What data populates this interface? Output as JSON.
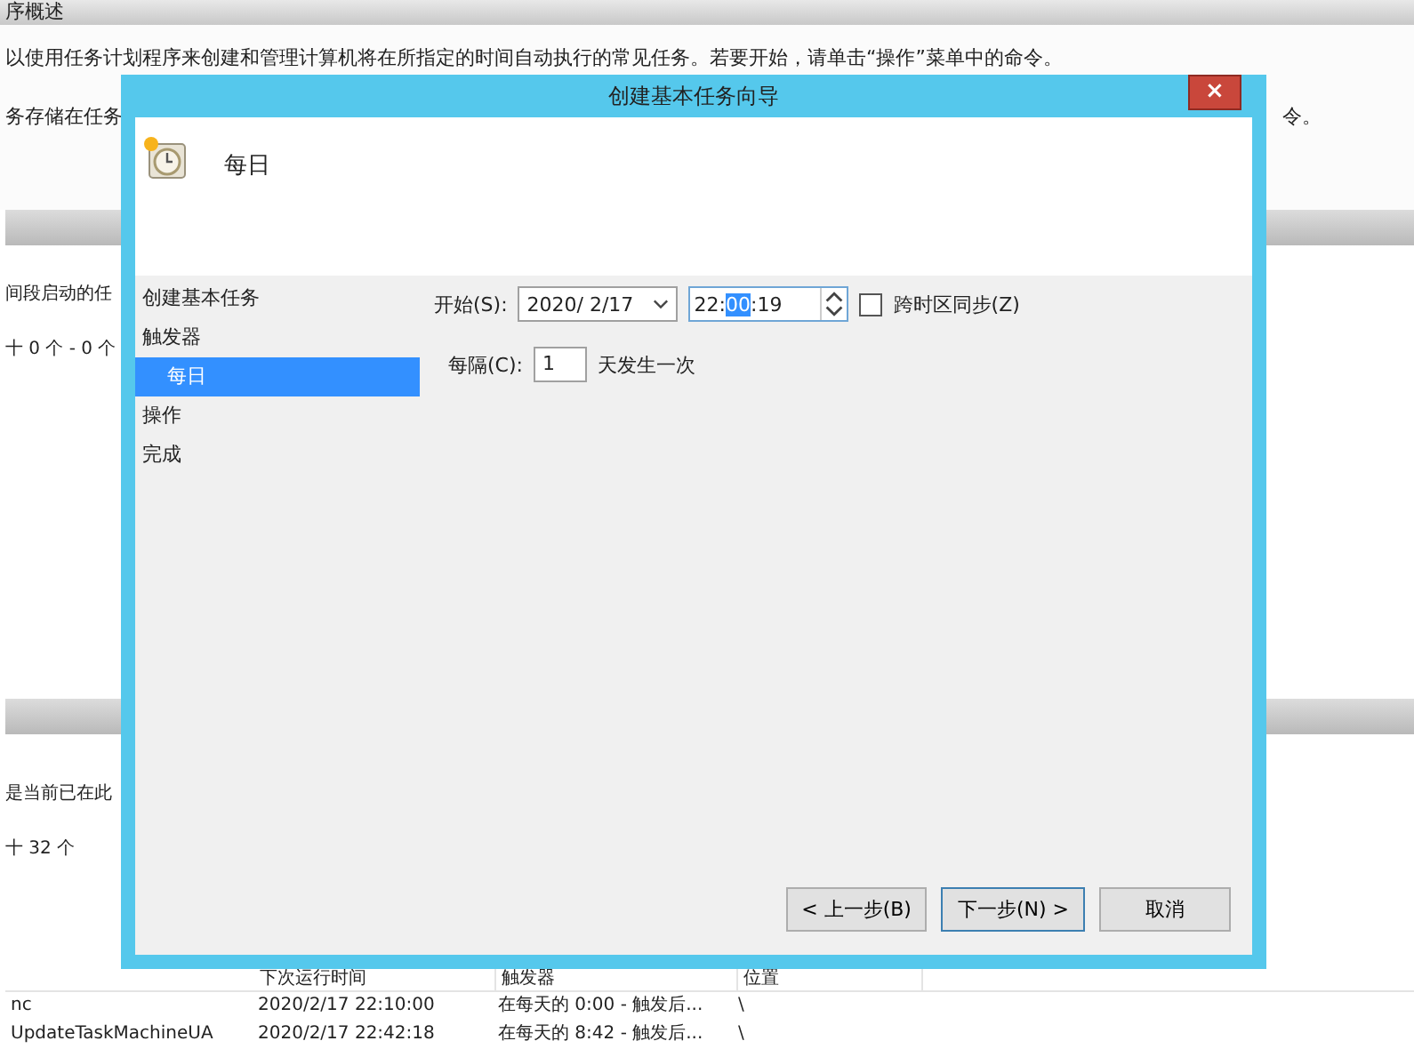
{
  "background": {
    "section_header": "序概述",
    "overview_text": "以使用任务计划程序来创建和管理计算机将在所指定的时间自动执行的常见任务。若要开始，请单击“操作”菜单中的命令。",
    "storage_text_left": "务存储在任务",
    "storage_text_right": "令。",
    "status_text": "间段启动的任",
    "status_count": "十 0 个 - 0 个",
    "active_text": "是当前已在此",
    "active_count": "十 32 个",
    "table": {
      "columns": [
        "",
        "下次运行时间",
        "触发器",
        "位置"
      ],
      "rows": [
        [
          "nc",
          "2020/2/17 22:10:00",
          "在每天的 0:00 - 触发后...",
          "\\"
        ],
        [
          "UpdateTaskMachineUA",
          "2020/2/17 22:42:18",
          "在每天的 8:42 - 触发后...",
          "\\"
        ]
      ]
    }
  },
  "dialog": {
    "title": "创建基本任务向导",
    "close": "×",
    "heading": "每日",
    "nav": [
      {
        "label": "创建基本任务",
        "selected": false
      },
      {
        "label": "触发器",
        "selected": false,
        "children": [
          {
            "label": "每日",
            "selected": true
          }
        ]
      },
      {
        "label": "操作",
        "selected": false
      },
      {
        "label": "完成",
        "selected": false
      }
    ],
    "start": {
      "label": "开始(S):",
      "date": "2020/  2/17",
      "time_before": "22:",
      "time_selected": "00",
      "time_after": ":19",
      "sync": {
        "label": "跨时区同步(Z)",
        "checked": false
      }
    },
    "recur": {
      "label": "每隔(C):",
      "value": "1",
      "suffix": "天发生一次"
    },
    "buttons": [
      "< 上一步(B)",
      "下一步(N) >",
      "取消"
    ]
  }
}
